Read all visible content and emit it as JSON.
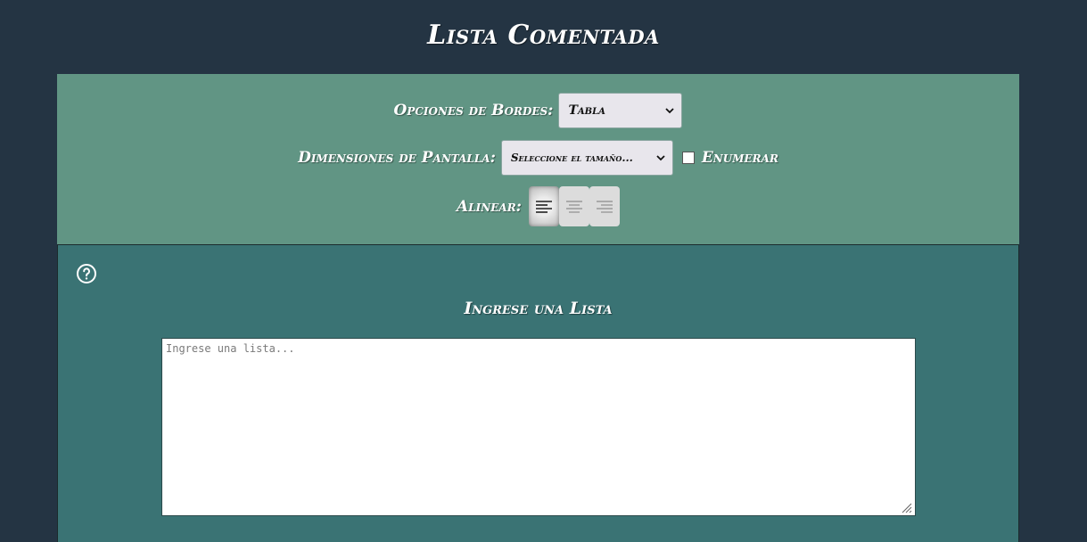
{
  "app": {
    "title": "Lista Comentada"
  },
  "options": {
    "borders": {
      "label": "Opciones de Bordes:",
      "selected": "Tabla"
    },
    "dimensions": {
      "label": "Dimensiones de Pantalla:",
      "selected": "Seleccione el tamaño..."
    },
    "enumerate": {
      "label": "Enumerar",
      "checked": false
    },
    "align": {
      "label": "Alinear:",
      "buttons": [
        {
          "icon": "align-left-icon",
          "active": true
        },
        {
          "icon": "align-center-icon",
          "active": false
        },
        {
          "icon": "align-right-icon",
          "active": false
        }
      ]
    }
  },
  "list": {
    "heading": "Ingrese una Lista",
    "placeholder": "Ingrese una lista...",
    "value": "",
    "help_icon": "help-circle-icon"
  },
  "colors": {
    "background": "#243443",
    "options_panel": "#619584",
    "list_panel": "#3a7374",
    "text": "#ffffff"
  }
}
